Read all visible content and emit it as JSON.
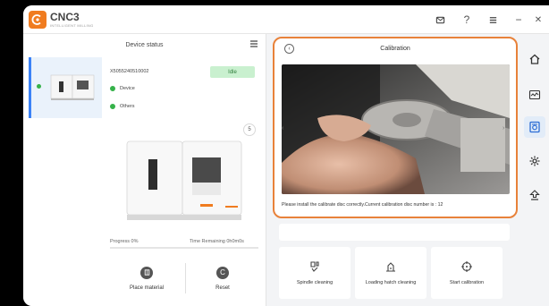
{
  "app": {
    "name": "CNC3",
    "subtitle": "Intelligent Milling"
  },
  "titlebar": {
    "icons": [
      "mail-icon",
      "help-icon",
      "menu-icon",
      "minimize-icon",
      "close-icon"
    ],
    "minimize_glyph": "−",
    "close_glyph": "✕",
    "help_glyph": "?"
  },
  "left": {
    "title": "Device status",
    "device": {
      "serial": "X5055240510002",
      "status": "Idle",
      "statuses": [
        "Device",
        "Others"
      ]
    },
    "pager": "5",
    "progress_label": "Progress 0%",
    "progress_value": 0,
    "time_remaining": "Time Remaining 0h0m0s",
    "buttons": [
      {
        "label": "Place material",
        "icon": "place-material-icon"
      },
      {
        "label": "Reset",
        "icon": "reset-icon",
        "glyph": "C"
      }
    ]
  },
  "calibration": {
    "title": "Calibration",
    "back_glyph": "‹",
    "prev_glyph": "‹",
    "next_glyph": "›",
    "instruction": "Please install the calibrate disc correctly.Current calibration disc number is : 12",
    "buttons": [
      {
        "label": "Spindle cleaning",
        "icon": "spindle-cleaning-icon"
      },
      {
        "label": "Loading hatch cleaning",
        "icon": "hatch-cleaning-icon"
      },
      {
        "label": "Start calibration",
        "icon": "start-calibration-icon"
      }
    ]
  },
  "sidebar": {
    "items": [
      "home-icon",
      "waveform-icon",
      "calibration-icon",
      "settings-icon",
      "upload-icon"
    ],
    "active": "calibration-icon"
  },
  "colors": {
    "accent": "#e8823a",
    "brand": "#f07c20",
    "idle_bg": "#c9f0cf",
    "status_green": "#36b24a",
    "active_blue": "#3b82f6"
  }
}
